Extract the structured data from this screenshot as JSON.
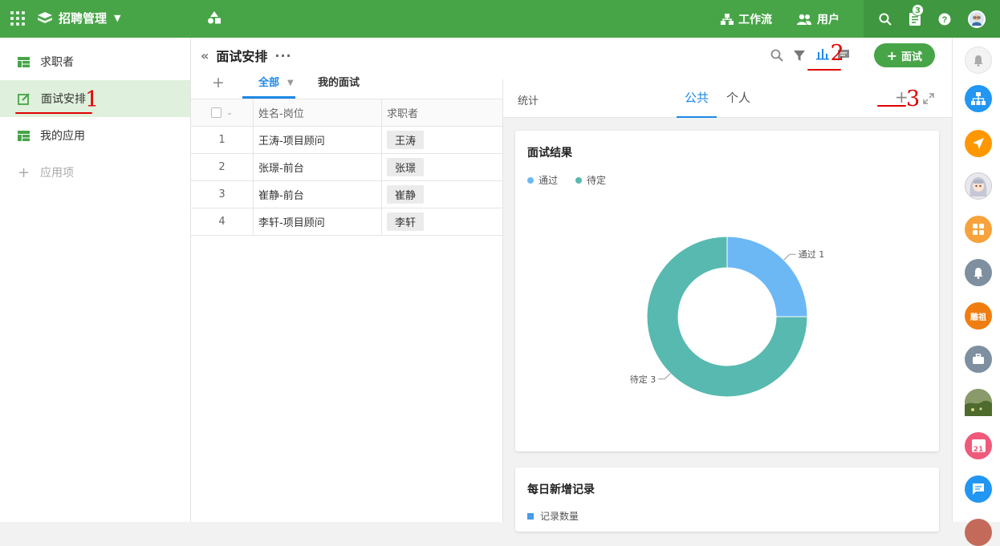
{
  "app": {
    "name": "招聘管理"
  },
  "topbar": {
    "workflow": "工作流",
    "users": "用户",
    "notify_count": "3"
  },
  "nav": {
    "items": [
      {
        "label": "求职者"
      },
      {
        "label": "面试安排"
      },
      {
        "label": "我的应用"
      },
      {
        "label": "应用项"
      }
    ]
  },
  "annotations": {
    "mark1": "1",
    "mark2": "2",
    "mark3": "3"
  },
  "view": {
    "title": "面试安排",
    "add_button": "面试"
  },
  "tabs": {
    "all": "全部",
    "mine": "我的面试"
  },
  "table": {
    "headers": {
      "name": "姓名-岗位",
      "applicant": "求职者"
    },
    "rows": [
      {
        "index": "1",
        "name": "王涛-项目顾问",
        "applicant": "王涛"
      },
      {
        "index": "2",
        "name": "张璟-前台",
        "applicant": "张璟"
      },
      {
        "index": "3",
        "name": "崔静-前台",
        "applicant": "崔静"
      },
      {
        "index": "4",
        "name": "李轩-项目顾问",
        "applicant": "李轩"
      }
    ]
  },
  "stats": {
    "label": "统计",
    "tab_public": "公共",
    "tab_personal": "个人"
  },
  "card1": {
    "title": "面试结果"
  },
  "card2": {
    "title": "每日新增记录",
    "legend": "记录数量"
  },
  "rightbar": {
    "group_badge": "雕祖",
    "calendar_day": "21"
  },
  "colors": {
    "brand": "#47a548",
    "accent": "#1e88e5",
    "pass": "#6cb8f5",
    "pending": "#57b9b0"
  },
  "chart_data": {
    "type": "pie",
    "title": "面试结果",
    "categories": [
      "通过",
      "待定"
    ],
    "values": [
      1,
      3
    ],
    "colors": [
      "#6cb8f5",
      "#57b9b0"
    ],
    "donut": true,
    "legend": "top-left"
  }
}
